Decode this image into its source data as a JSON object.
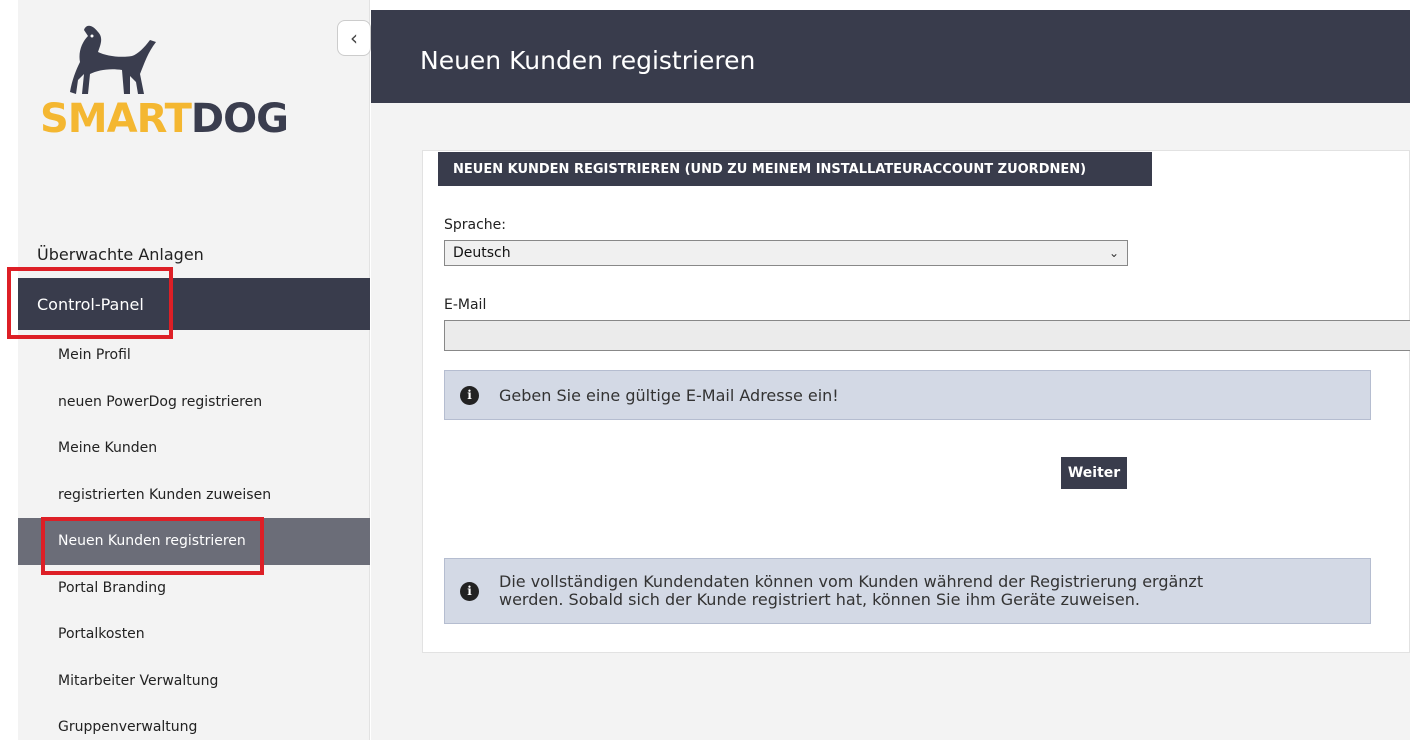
{
  "brand": {
    "smart": "SMART",
    "dog": "DOG"
  },
  "header": {
    "title": "Neuen Kunden registrieren"
  },
  "nav": {
    "top_items": [
      {
        "label": "Überwachte Anlagen"
      },
      {
        "label": "Control-Panel",
        "active": true
      }
    ],
    "sub_items": [
      {
        "label": "Mein Profil"
      },
      {
        "label": "neuen PowerDog registrieren"
      },
      {
        "label": "Meine Kunden"
      },
      {
        "label": "registrierten Kunden zuweisen"
      },
      {
        "label": "Neuen Kunden registrieren",
        "active": true
      },
      {
        "label": "Portal Branding"
      },
      {
        "label": "Portalkosten"
      },
      {
        "label": "Mitarbeiter Verwaltung"
      },
      {
        "label": "Gruppenverwaltung"
      }
    ]
  },
  "form": {
    "section_title": "NEUEN KUNDEN REGISTRIEREN (UND ZU MEINEM INSTALLATEURACCOUNT ZUORDNEN)",
    "language_label": "Sprache:",
    "language_value": "Deutsch",
    "email_label": "E-Mail",
    "email_value": "",
    "email_hint": "Geben Sie eine gültige E-Mail Adresse ein!",
    "submit_label": "Weiter",
    "info_line1": "Die vollständigen Kundendaten können vom Kunden während der Registrierung ergänzt",
    "info_line2": "werden. Sobald sich der Kunde registriert hat, können Sie ihm Geräte zuweisen."
  },
  "colors": {
    "brand_dark": "#393c4c",
    "brand_yellow": "#f4b731",
    "active_sub": "#6b6d78",
    "highlight_red": "#dd1f26",
    "info_bg": "#d3d9e5"
  },
  "icons": {
    "collapse": "chevron-left-icon",
    "info": "info-circle-icon",
    "select": "chevron-down-icon"
  }
}
